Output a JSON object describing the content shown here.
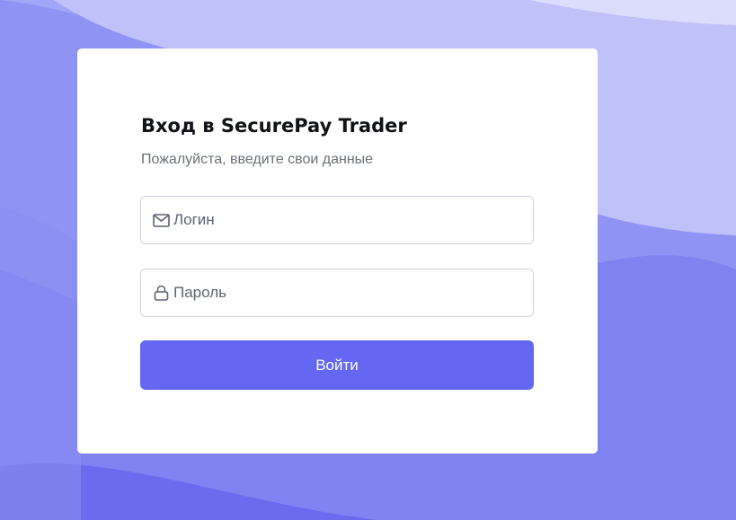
{
  "login_form": {
    "title_prefix": "Вход в",
    "title_brand": "SecurePay Trader",
    "subtitle": "Пожалуйста, введите свои данные",
    "login_field": {
      "placeholder": "Логин",
      "value": "",
      "icon": "mail-icon"
    },
    "password_field": {
      "placeholder": "Пароль",
      "value": "",
      "icon": "lock-icon"
    },
    "submit_label": "Войти"
  },
  "colors": {
    "accent": "#6367f1",
    "background": "#7d7ff0",
    "card": "#ffffff",
    "title": "#111318",
    "subtitle": "#6b6f79",
    "field_border": "#cfd2dc"
  }
}
